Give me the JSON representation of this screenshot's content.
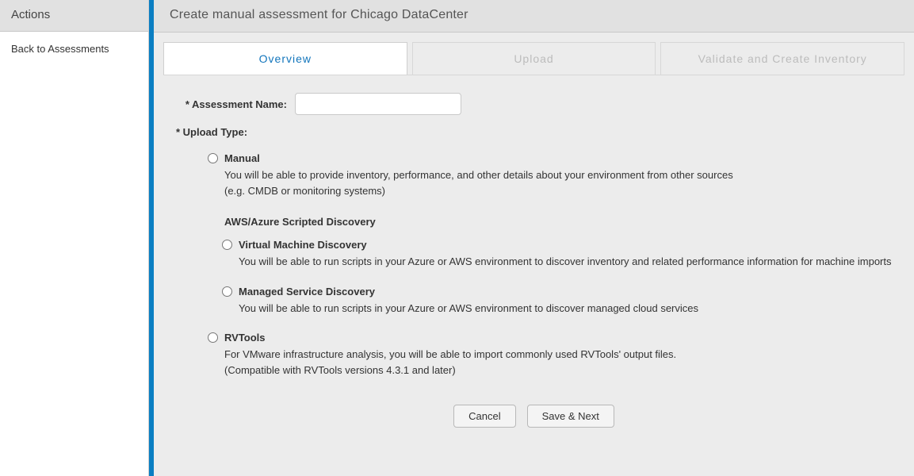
{
  "sidebar": {
    "title": "Actions",
    "back_link": "Back to Assessments"
  },
  "header": {
    "title": "Create manual assessment for Chicago DataCenter"
  },
  "tabs": [
    {
      "label": "Overview",
      "active": true
    },
    {
      "label": "Upload",
      "active": false
    },
    {
      "label": "Validate and Create Inventory",
      "active": false
    }
  ],
  "form": {
    "assessment_name_label": "* Assessment Name:",
    "assessment_name_value": "",
    "upload_type_label": "* Upload Type:",
    "options": {
      "manual": {
        "title": "Manual",
        "desc_line1": "You will be able to provide inventory, performance, and other details about your environment from other sources",
        "desc_line2": "(e.g. CMDB or monitoring systems)"
      },
      "scripted_heading": "AWS/Azure Scripted Discovery",
      "vm": {
        "title": "Virtual Machine Discovery",
        "desc": "You will be able to run scripts in your Azure or AWS environment to discover inventory and related performance information for machine imports"
      },
      "managed": {
        "title": "Managed Service Discovery",
        "desc": "You will be able to run scripts in your Azure or AWS environment to discover managed cloud services"
      },
      "rvtools": {
        "title": "RVTools",
        "desc_line1": "For VMware infrastructure analysis, you will be able to import commonly used RVTools' output files.",
        "desc_line2": "(Compatible with RVTools versions 4.3.1 and later)"
      }
    }
  },
  "buttons": {
    "cancel": "Cancel",
    "save_next": "Save & Next"
  }
}
